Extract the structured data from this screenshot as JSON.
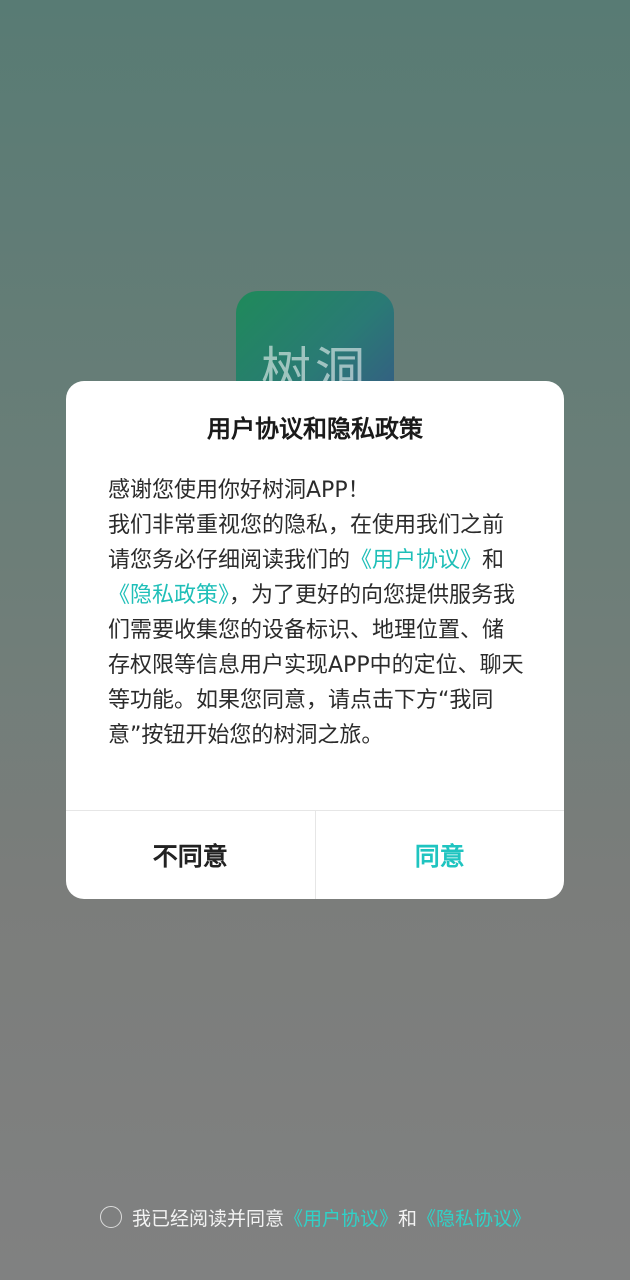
{
  "app": {
    "logo_text": "树洞"
  },
  "modal": {
    "title": "用户协议和隐私政策",
    "body": {
      "p1": "感谢您使用你好树洞APP！",
      "p2_start": "我们非常重视您的隐私，在使用我们之前请您务必仔细阅读我们的",
      "link_user_agreement": "《用户协议》",
      "and": "和",
      "link_privacy_policy": "《隐私政策》",
      "p2_end": "，为了更好的向您提供服务我们需要收集您的设备标识、地理位置、储存权限等信息用户实现APP中的定位、聊天等功能。如果您同意，请点击下方“我同意”按钮开始您的树洞之旅。"
    },
    "actions": {
      "disagree_label": "不同意",
      "agree_label": "同意"
    }
  },
  "consent": {
    "prefix": "我已经阅读并同意",
    "link_user_agreement": "《用户协议》",
    "and": "和",
    "link_privacy_agreement": "《隐私协议》"
  },
  "colors": {
    "accent": "#1fc4c0",
    "link": "#1fbfb8"
  }
}
